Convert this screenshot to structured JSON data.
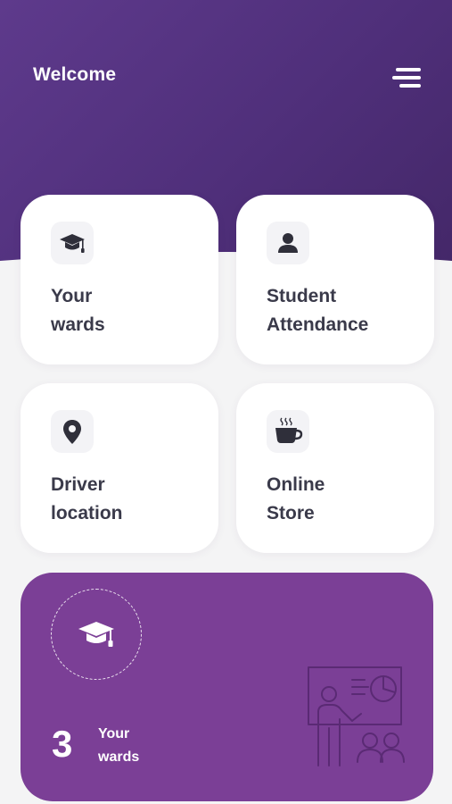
{
  "header": {
    "title": "Welcome",
    "menu_icon": "menu-icon"
  },
  "tiles": [
    {
      "label": "Your\nwards",
      "icon": "graduation-cap-icon"
    },
    {
      "label": "Student\nAttendance",
      "icon": "person-icon"
    },
    {
      "label": "Driver\nlocation",
      "icon": "location-pin-icon"
    },
    {
      "label": "Online\nStore",
      "icon": "coffee-cup-icon"
    }
  ],
  "summary": {
    "count": "3",
    "label": "Your\nwards",
    "icon": "graduation-cap-icon",
    "illustration": "teacher-presentation-icon"
  },
  "colors": {
    "header_bg": "#53327f",
    "summary_bg": "#7b3f96",
    "page_bg": "#f4f4f5",
    "tile_text": "#3a3a4a"
  }
}
